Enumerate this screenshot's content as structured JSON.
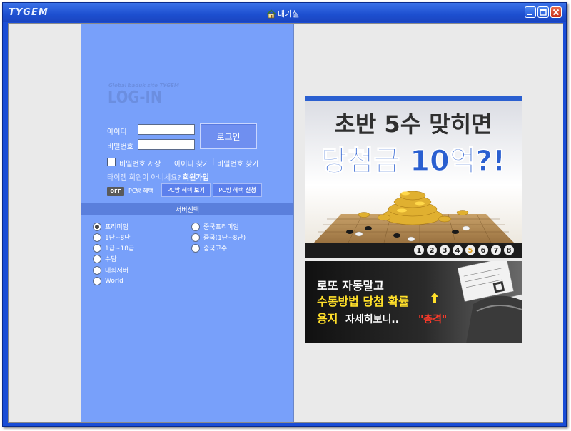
{
  "window": {
    "app_title": "TYGEM",
    "title": "대기실"
  },
  "login": {
    "brand_small": "Global baduk site TYGEM",
    "brand_big": "LOG-IN",
    "id_label": "아이디",
    "id_value": "",
    "password_label": "비밀번호",
    "password_value": "",
    "login_button": "로그인",
    "save_password_label": "비밀번호 저장",
    "find_id": "아이디 찾기",
    "separator": "|",
    "find_password": "비밀번호 찾기",
    "signup_question": "타이젬 회원이 아니세요?",
    "signup_link": "회원가입",
    "pc_toggle": "OFF",
    "pc_label": "PC방 혜택",
    "pc_view_prefix": "PC방 혜택",
    "pc_view_bold": "보기",
    "pc_apply_prefix": "PC방 혜택",
    "pc_apply_bold": "신청"
  },
  "server": {
    "header": "서버선택",
    "left": [
      {
        "label": "프리미엄",
        "checked": true
      },
      {
        "label": "1단~8단",
        "checked": false
      },
      {
        "label": "1급~18급",
        "checked": false
      },
      {
        "label": "수담",
        "checked": false
      },
      {
        "label": "대회서버",
        "checked": false
      },
      {
        "label": "World",
        "checked": false
      }
    ],
    "right": [
      {
        "label": "중국프리미엄",
        "checked": false
      },
      {
        "label": "중국(1단~8단)",
        "checked": false
      },
      {
        "label": "중국고수",
        "checked": false
      }
    ]
  },
  "ads": {
    "banner1": {
      "line1": "초반 5수 맞히면",
      "line2": "당첨금 10억?!",
      "numbers": [
        "1",
        "2",
        "3",
        "4",
        "5",
        "6",
        "7",
        "8"
      ],
      "highlight_index": 4
    },
    "banner2": {
      "line1": "로또 자동말고",
      "line2": "수동방법 당첨 확률",
      "line3_a": "용지",
      "line3_b": "자세히보니..",
      "line3_c": "\"충격\""
    }
  },
  "colors": {
    "titlebar": "#1d4fd0",
    "login_panel": "#78a0fa",
    "server_header": "#5a7fdc",
    "banner_yellow": "#ffdf2a",
    "banner_blue": "#2a5fd0"
  }
}
